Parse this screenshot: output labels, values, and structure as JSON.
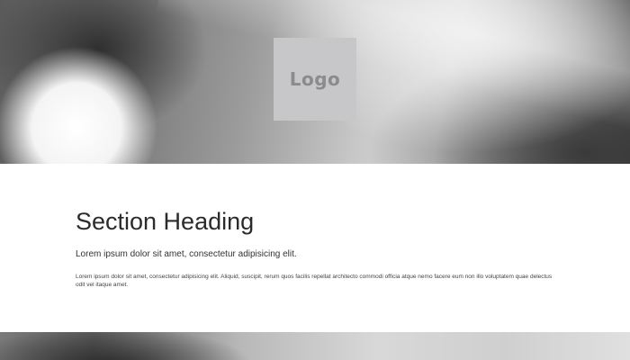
{
  "hero": {
    "logo_label": "Logo"
  },
  "section": {
    "heading": "Section Heading",
    "lead": "Lorem ipsum dolor sit amet, consectetur adipisicing elit.",
    "body": "Lorem ipsum dolor sit amet, consectetur adipisicing elit. Aliquid, suscipit, rerum quos facilis repellat architecto commodi officia atque nemo facere eum non illo voluptatem quae delectus odit vel itaque amet."
  }
}
